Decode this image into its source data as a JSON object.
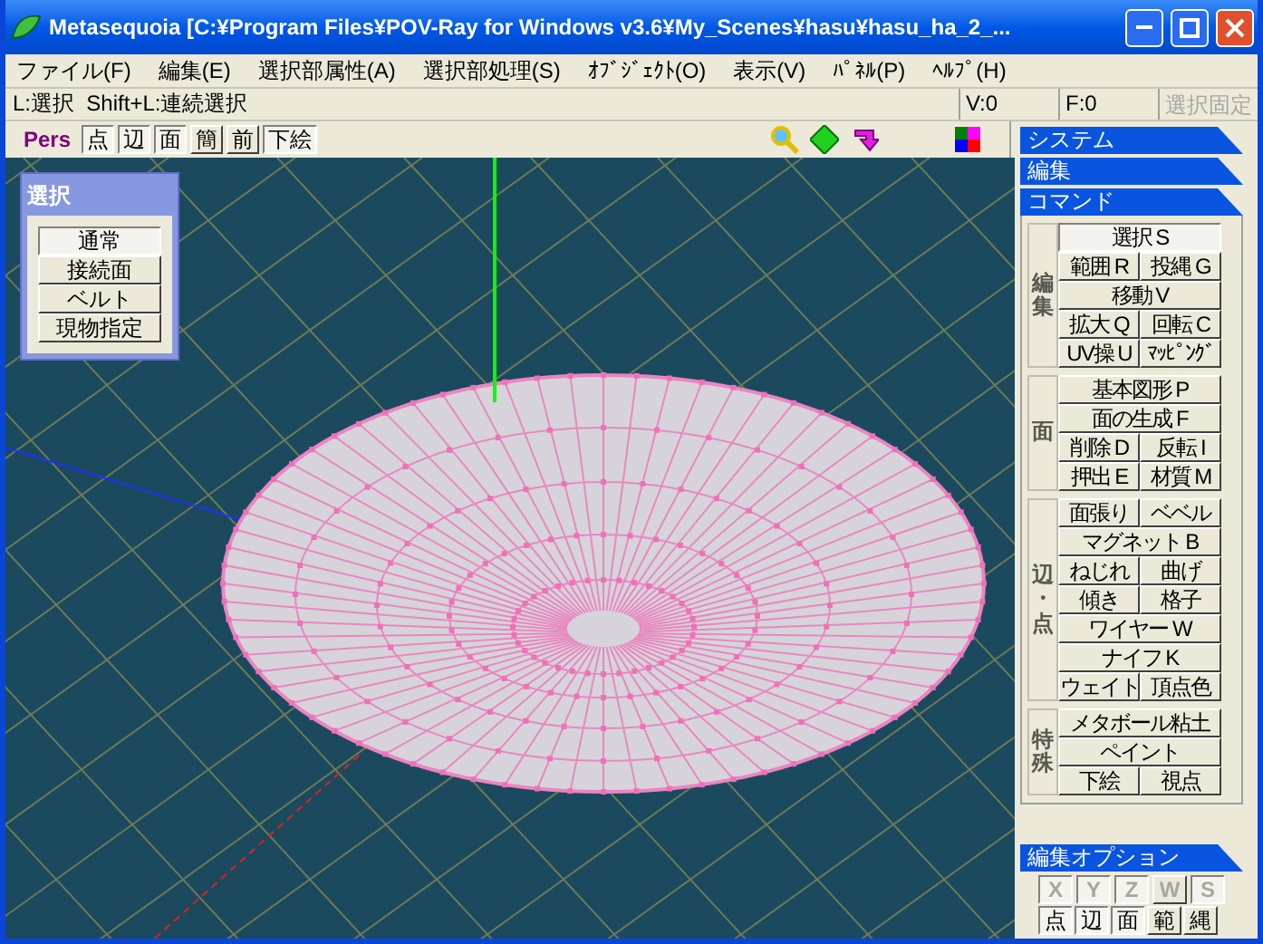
{
  "window": {
    "title": "Metasequoia [C:¥Program Files¥POV-Ray for Windows v3.6¥My_Scenes¥hasu¥hasu_ha_2_..."
  },
  "menu": [
    "ファイル(F)",
    "編集(E)",
    "選択部属性(A)",
    "選択部処理(S)",
    "ｵﾌﾞｼﾞｪｸﾄ(O)",
    "表示(V)",
    "ﾊﾟﾈﾙ(P)",
    "ﾍﾙﾌﾟ(H)"
  ],
  "status": {
    "hint": "L:選択  Shift+L:連続選択",
    "vertex_count": "V:0",
    "face_count": "F:0",
    "lock_button": {
      "label": "選択固定",
      "disabled": true
    }
  },
  "view_toolbar": {
    "projection": "Pers",
    "buttons": [
      {
        "label": "点",
        "selected": true
      },
      {
        "label": "辺",
        "selected": true
      },
      {
        "label": "面",
        "selected": true
      },
      {
        "label": "簡",
        "selected": false
      },
      {
        "label": "前",
        "selected": false
      },
      {
        "label": "下絵",
        "selected": true
      }
    ]
  },
  "select_panel": {
    "title": "選択",
    "buttons": [
      {
        "label": "通常",
        "selected": true
      },
      {
        "label": "接続面",
        "selected": false
      },
      {
        "label": "ベルト",
        "selected": false
      },
      {
        "label": "現物指定",
        "selected": false
      }
    ]
  },
  "sidebar": {
    "headers": [
      "システム",
      "編集"
    ],
    "command_title": "コマンド",
    "groups": [
      {
        "label": "編集",
        "rows": [
          [
            {
              "label": "選択 S",
              "selected": true
            }
          ],
          [
            {
              "label": "範囲 R",
              "selected": false
            },
            {
              "label": "投縄 G",
              "selected": false
            }
          ],
          [
            {
              "label": "移動 V",
              "selected": false
            }
          ],
          [
            {
              "label": "拡大 Q",
              "selected": false
            },
            {
              "label": "回転 C",
              "selected": false
            }
          ],
          [
            {
              "label": "UV操 U",
              "selected": false
            },
            {
              "label": "ﾏｯﾋﾟﾝｸﾞ",
              "selected": false
            }
          ]
        ]
      },
      {
        "label": "面",
        "rows": [
          [
            {
              "label": "基本図形 P",
              "selected": false
            }
          ],
          [
            {
              "label": "面の生成 F",
              "selected": false
            }
          ],
          [
            {
              "label": "削除 D",
              "selected": false
            },
            {
              "label": "反転 I",
              "selected": false
            }
          ],
          [
            {
              "label": "押出 E",
              "selected": false
            },
            {
              "label": "材質 M",
              "selected": false
            }
          ]
        ]
      },
      {
        "label": "辺・点",
        "rows": [
          [
            {
              "label": "面張り",
              "selected": false
            },
            {
              "label": "ベベル",
              "selected": false
            }
          ],
          [
            {
              "label": "マグネット B",
              "selected": false
            }
          ],
          [
            {
              "label": "ねじれ",
              "selected": false
            },
            {
              "label": "曲げ",
              "selected": false
            }
          ],
          [
            {
              "label": "傾き",
              "selected": false
            },
            {
              "label": "格子",
              "selected": false
            }
          ],
          [
            {
              "label": "ワイヤー W",
              "selected": false
            }
          ],
          [
            {
              "label": "ナイフ K",
              "selected": false
            }
          ],
          [
            {
              "label": "ウェイト",
              "selected": false
            },
            {
              "label": "頂点色",
              "selected": false
            }
          ]
        ]
      },
      {
        "label": "特殊",
        "rows": [
          [
            {
              "label": "メタボール粘土",
              "selected": false
            }
          ],
          [
            {
              "label": "ペイント",
              "selected": false
            }
          ],
          [
            {
              "label": "下絵",
              "selected": false
            },
            {
              "label": "視点",
              "selected": false
            }
          ]
        ]
      }
    ]
  },
  "edit_options": {
    "title": "編集オプション",
    "axes": [
      {
        "label": "X",
        "selected": true,
        "disabled": true
      },
      {
        "label": "Y",
        "selected": true,
        "disabled": true
      },
      {
        "label": "Z",
        "selected": true,
        "disabled": true
      },
      {
        "label": "W",
        "selected": false,
        "disabled": true
      },
      {
        "label": "S",
        "selected": true,
        "disabled": true
      }
    ],
    "modes": [
      {
        "label": "点",
        "selected": true
      },
      {
        "label": "辺",
        "selected": true
      },
      {
        "label": "面",
        "selected": true
      },
      {
        "label": "範",
        "selected": false
      },
      {
        "label": "縄",
        "selected": false
      }
    ]
  }
}
